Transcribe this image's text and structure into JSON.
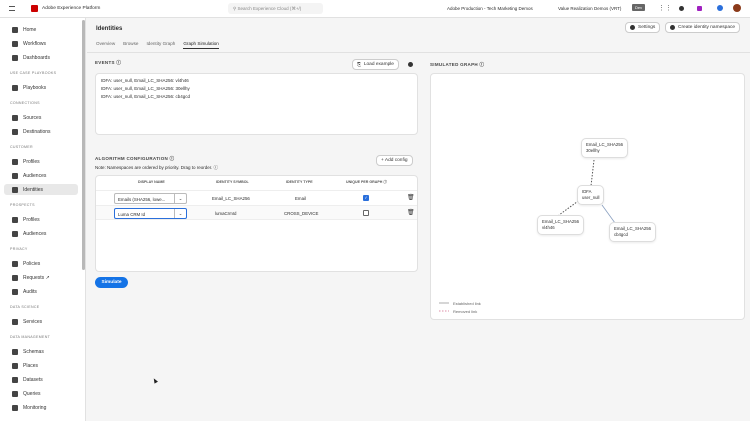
{
  "topbar": {
    "app_name": "Adobe Experience Platform",
    "search_placeholder": "Search Experience Cloud (⌘+/)",
    "org": "Adobe Production - Tech Marketing Demos",
    "sandbox": "Value Realization Demos (VRT)",
    "sandbox_badge": "Dev"
  },
  "sidebar": [
    {
      "type": "item",
      "label": "Home"
    },
    {
      "type": "item",
      "label": "Workflows"
    },
    {
      "type": "item",
      "label": "Dashboards"
    },
    {
      "type": "section",
      "label": "USE CASE PLAYBOOKS"
    },
    {
      "type": "item",
      "label": "Playbooks"
    },
    {
      "type": "section",
      "label": "CONNECTIONS"
    },
    {
      "type": "item",
      "label": "Sources"
    },
    {
      "type": "item",
      "label": "Destinations"
    },
    {
      "type": "section",
      "label": "CUSTOMER"
    },
    {
      "type": "item",
      "label": "Profiles"
    },
    {
      "type": "item",
      "label": "Audiences"
    },
    {
      "type": "item",
      "label": "Identities",
      "selected": true
    },
    {
      "type": "section",
      "label": "PROSPECTS"
    },
    {
      "type": "item",
      "label": "Profiles"
    },
    {
      "type": "item",
      "label": "Audiences"
    },
    {
      "type": "section",
      "label": "PRIVACY"
    },
    {
      "type": "item",
      "label": "Policies"
    },
    {
      "type": "item",
      "label": "Requests ↗"
    },
    {
      "type": "item",
      "label": "Audits"
    },
    {
      "type": "section",
      "label": "DATA SCIENCE"
    },
    {
      "type": "item",
      "label": "Services"
    },
    {
      "type": "section",
      "label": "DATA MANAGEMENT"
    },
    {
      "type": "item",
      "label": "Schemas"
    },
    {
      "type": "item",
      "label": "Places"
    },
    {
      "type": "item",
      "label": "Datasets"
    },
    {
      "type": "item",
      "label": "Queries"
    },
    {
      "type": "item",
      "label": "Monitoring"
    }
  ],
  "header": {
    "title": "Identities",
    "settings": "Settings",
    "create": "Create identity namespace",
    "tabs": [
      "Overview",
      "Browse",
      "Identity Graph",
      "Graph Simulation"
    ]
  },
  "events": {
    "label": "EVENTS",
    "load_example": "Load example",
    "lines": [
      "IDFA: user_null, Email_LC_SHA256: vl4h46",
      "IDFA: user_null, Email_LC_SHA256: 30ellhy",
      "IDFA: user_null, Email_LC_SHA256: cb4gcd"
    ]
  },
  "algo": {
    "label": "ALGORITHM CONFIGURATION",
    "note": "Note: Namespaces are ordered by priority. Drag to reorder.",
    "add": "+ Add config",
    "columns": [
      "DISPLAY NAME",
      "IDENTITY SYMBOL",
      "IDENTITY TYPE",
      "UNIQUE PER GRAPH"
    ],
    "rows": [
      {
        "name": "Emails (SHA256, lowe...",
        "symbol": "Email_LC_SHA256",
        "type": "Email",
        "unique": true
      },
      {
        "name": "Luma CRM Id",
        "symbol": "lumaCrmId",
        "type": "CROSS_DEVICE",
        "unique": false
      }
    ]
  },
  "simulate": "Simulate",
  "graph": {
    "label": "SIMULATED GRAPH",
    "nodes": [
      {
        "l1": "Email_LC_SHA256",
        "l2": "30ellhy"
      },
      {
        "l1": "IDFA",
        "l2": "user_null"
      },
      {
        "l1": "Email_LC_SHA256",
        "l2": "vl4h46"
      },
      {
        "l1": "Email_LC_SHA256",
        "l2": "cb4gcd"
      }
    ],
    "legend": [
      "Established link",
      "Removed link"
    ],
    "colors": {
      "established": "#8aa0c0",
      "removed": "#d46a8a"
    }
  }
}
